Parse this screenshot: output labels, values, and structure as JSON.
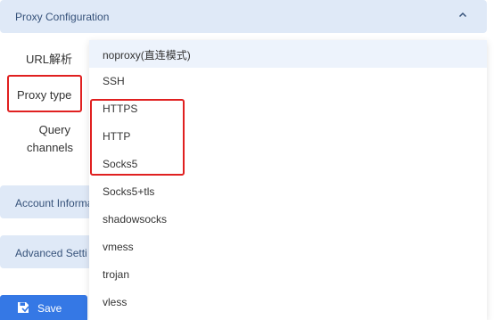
{
  "sections": {
    "proxy_configuration": "Proxy Configuration",
    "account_information": "Account Informa",
    "advanced_settings": "Advanced Setti"
  },
  "form": {
    "url_label": "URL解析",
    "proxy_type_label": "Proxy type",
    "query_channels_label": "Query channels"
  },
  "dropdown": {
    "options": [
      "noproxy(直连模式)",
      "SSH",
      "HTTPS",
      "HTTP",
      "Socks5",
      "Socks5+tls",
      "shadowsocks",
      "vmess",
      "trojan",
      "vless"
    ]
  },
  "footer": {
    "save_label": "Save"
  },
  "colors": {
    "accent": "#3578e5",
    "section_bg": "#dfe9f7",
    "highlight_red": "#e02020",
    "selected_option_bg": "#edf3fc"
  },
  "icons": {
    "chevron": "chevron-up-icon",
    "save": "save-icon"
  }
}
